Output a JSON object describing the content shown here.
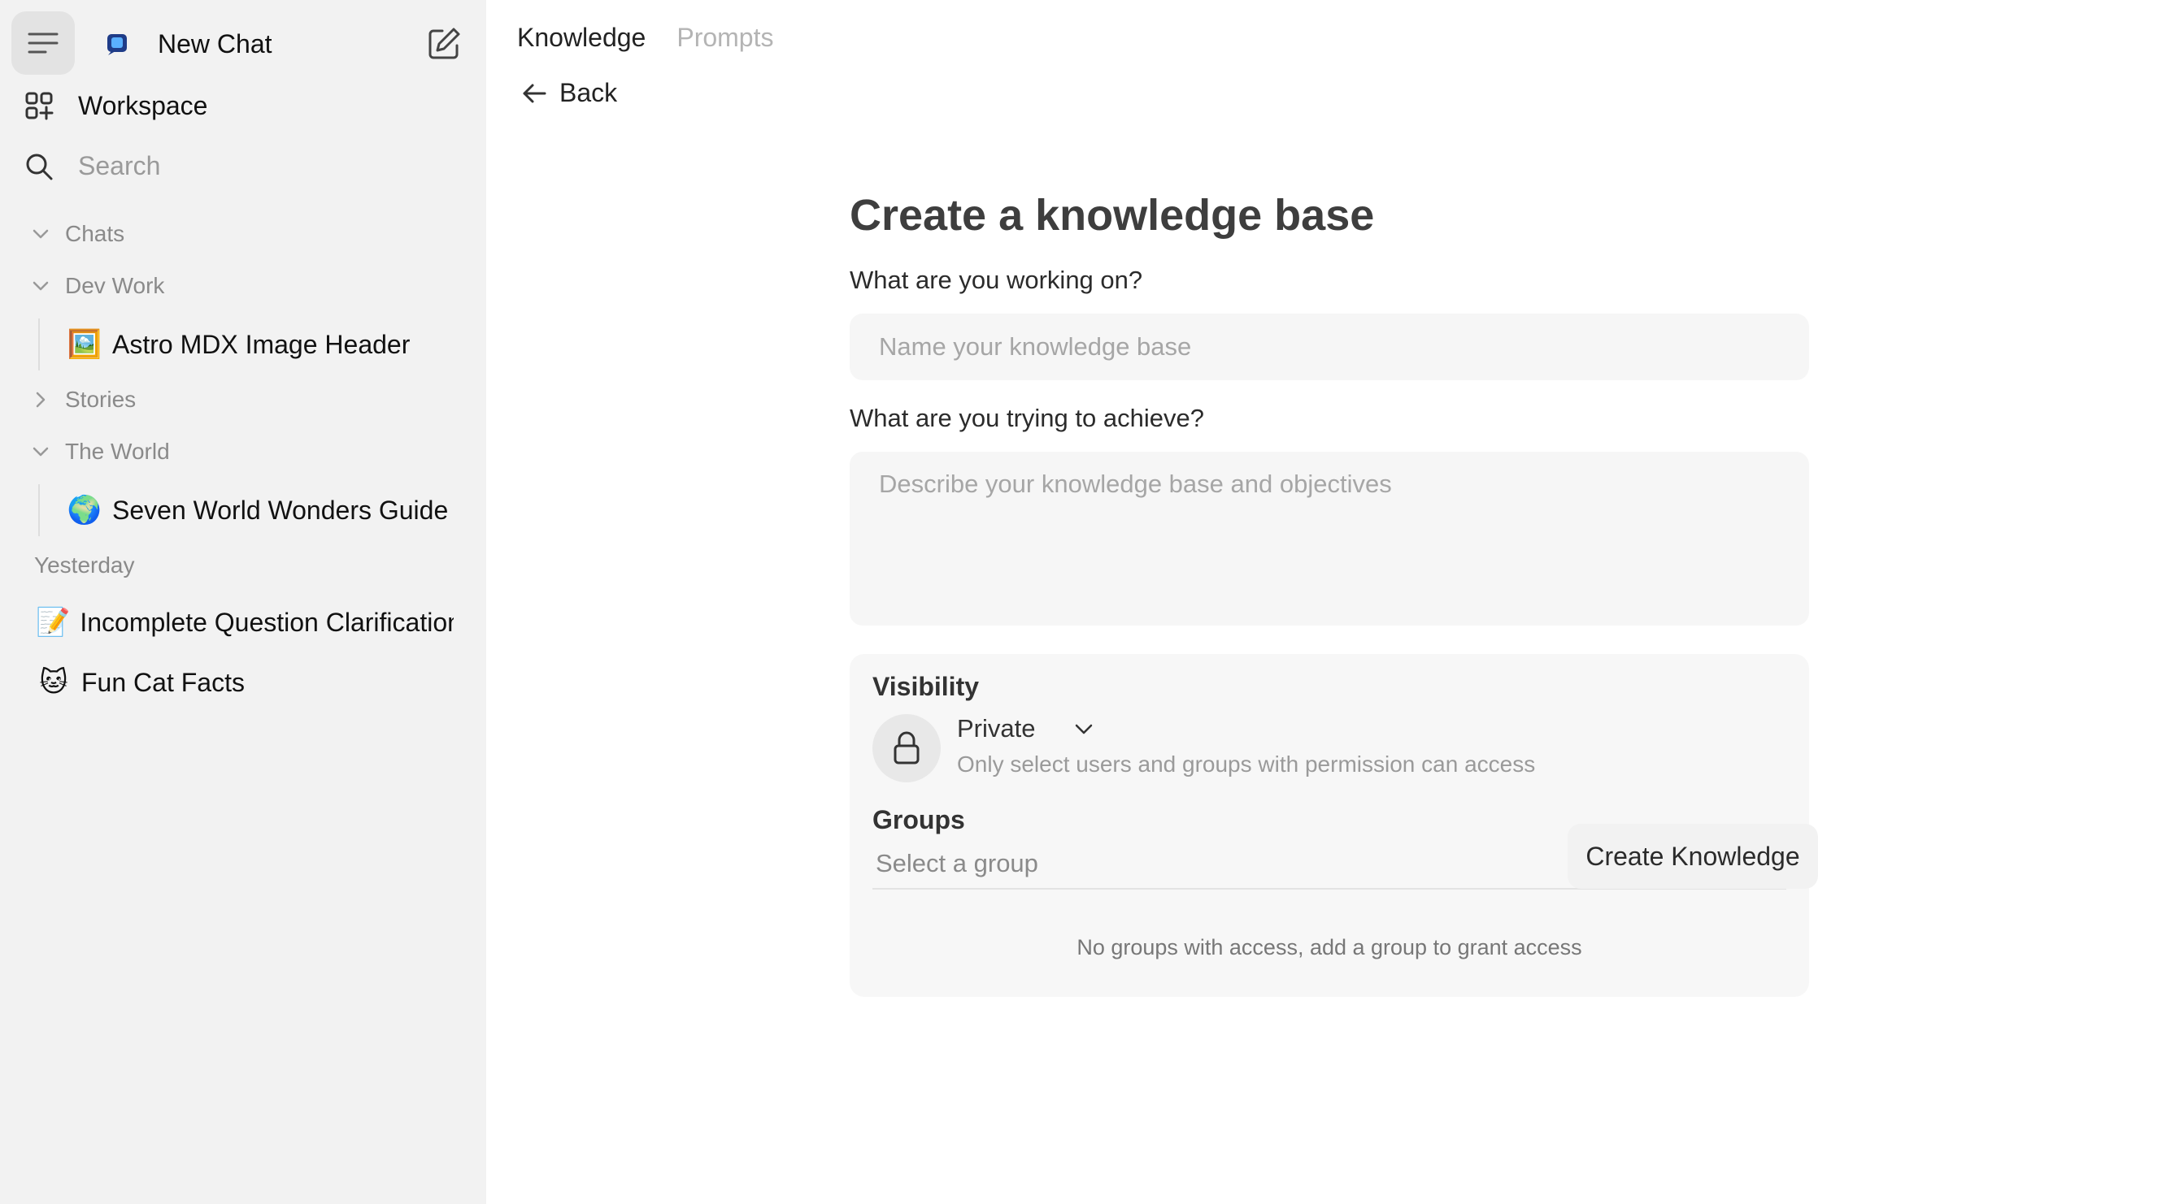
{
  "sidebar": {
    "new_chat_label": "New Chat",
    "workspace_label": "Workspace",
    "search_placeholder": "Search",
    "folders": {
      "chats": "Chats",
      "dev_work": "Dev Work",
      "stories": "Stories",
      "the_world": "The World"
    },
    "chats": {
      "astro": {
        "emoji": "🖼️",
        "title": "Astro MDX Image Header"
      },
      "wonders": {
        "emoji": "🌍",
        "title": "Seven World Wonders Guide"
      },
      "incomplete": {
        "emoji": "📝",
        "title": "Incomplete Question Clarification"
      },
      "cat": {
        "emoji": "🐱",
        "title": "Fun Cat Facts"
      }
    },
    "section_yesterday": "Yesterday"
  },
  "main": {
    "tabs": [
      "Knowledge",
      "Prompts"
    ],
    "back_label": "Back",
    "form": {
      "title": "Create a knowledge base",
      "q1_label": "What are you working on?",
      "name_placeholder": "Name your knowledge base",
      "q2_label": "What are you trying to achieve?",
      "description_placeholder": "Describe your knowledge base and objectives",
      "visibility": {
        "title": "Visibility",
        "selected": "Private",
        "description": "Only select users and groups with permission can access"
      },
      "groups": {
        "title": "Groups",
        "placeholder": "Select a group",
        "empty_text": "No groups with access, add a group to grant access"
      },
      "submit_label": "Create Knowledge"
    }
  }
}
